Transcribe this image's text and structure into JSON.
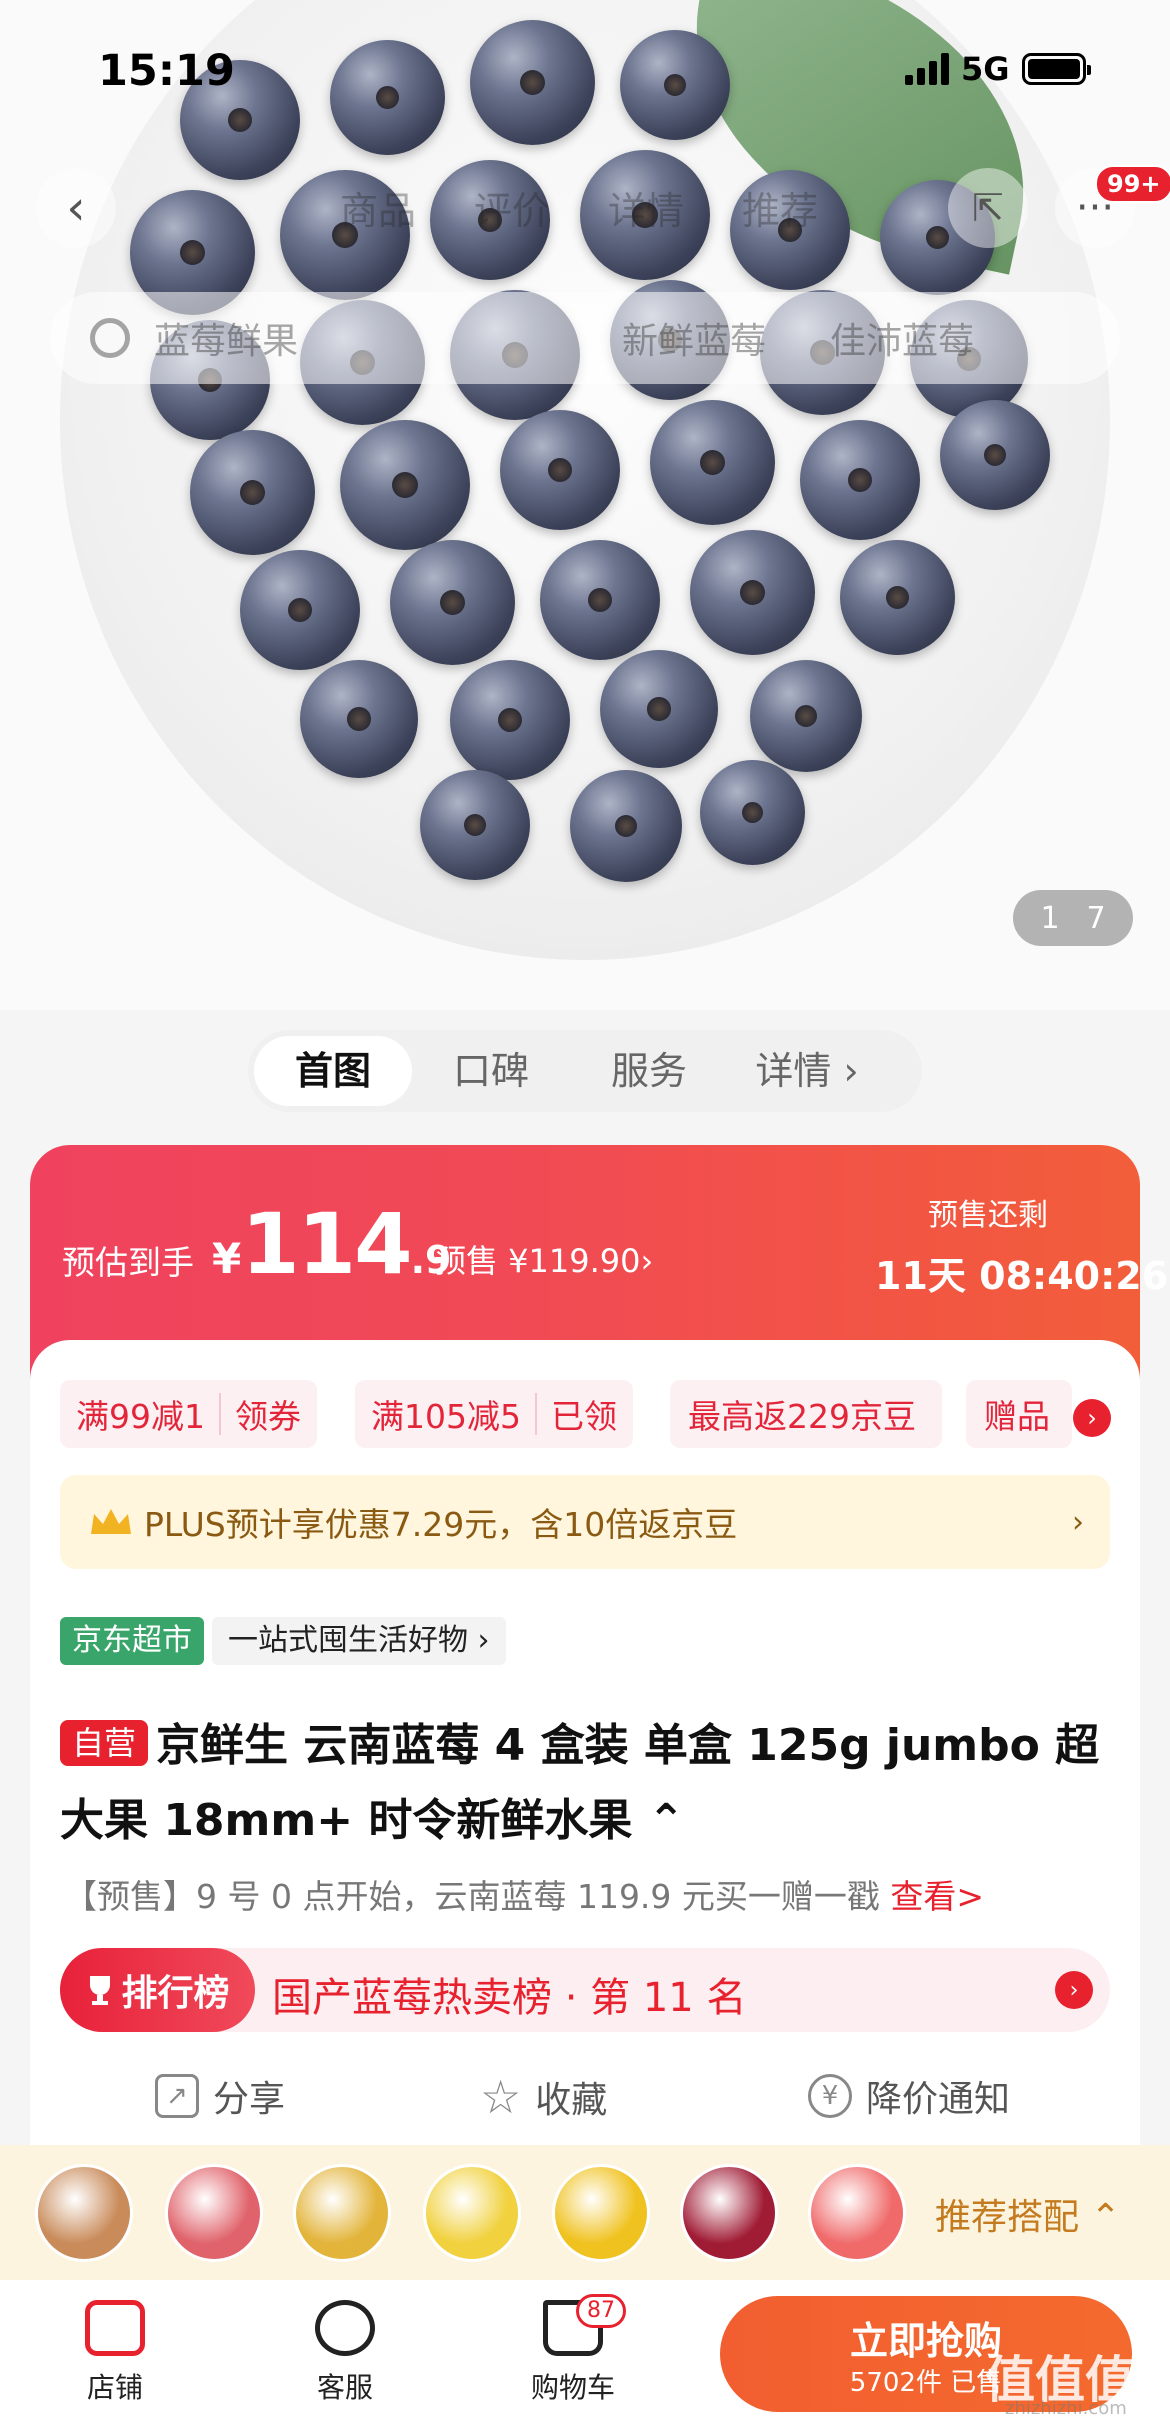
{
  "status": {
    "time": "15:19",
    "network": "5G"
  },
  "nav": {
    "tabs": [
      "商品",
      "评价",
      "详情",
      "推荐"
    ],
    "search_placeholder": "蓝莓鲜果",
    "search_hint2": "新鲜蓝莓",
    "search_hint3": "佳沛蓝莓",
    "badge": "99+"
  },
  "gallery": {
    "current": "1",
    "total": "7"
  },
  "segments": [
    "首图",
    "口碑",
    "服务",
    "详情 ›"
  ],
  "price": {
    "est_label": "预估到手",
    "currency": "¥",
    "int": "114",
    "dec": ".9",
    "presale": "预售 ¥119.90›",
    "left_label": "预售还剩",
    "countdown_days": "11天",
    "countdown_time": "08:40:26"
  },
  "coupons": [
    {
      "left": "满99减1",
      "right": "领券"
    },
    {
      "left": "满105减5",
      "right": "已领"
    },
    {
      "left": "最高返229京豆",
      "right": ""
    },
    {
      "left": "赠品",
      "right": ""
    }
  ],
  "plus": {
    "text": "PLUS预计享优惠7.29元，含10倍返京豆",
    "arrow": "›"
  },
  "store": {
    "tag": "京东超市",
    "slogan": "一站式囤生活好物 ›"
  },
  "product": {
    "self_tag": "自营",
    "title": "京鲜生 云南蓝莓 4 盒装 单盒 125g jumbo 超大果 18mm+ 时令新鲜水果 ⌃",
    "presale_note": "【预售】9 号 0 点开始，云南蓝莓 119.9 元买一赠一戳 ",
    "presale_link": "查看>"
  },
  "rank": {
    "tag": "排行榜",
    "text": "国产蓝莓热卖榜 · 第 11 名"
  },
  "actions": {
    "share": "分享",
    "fav": "收藏",
    "notify": "降价通知"
  },
  "recommend": {
    "label": "推荐搭配 ⌃",
    "thumb_colors": [
      "#c98b5a",
      "#e0636b",
      "#e3b43a",
      "#f1d13d",
      "#f0c21f",
      "#a01c35",
      "#f06a6a"
    ]
  },
  "bottom": {
    "shop": "店铺",
    "service": "客服",
    "cart": "购物车",
    "cart_count": "87",
    "buy_main": "立即抢购",
    "buy_sub": "5702件 已售"
  },
  "watermark": {
    "main": "值值值",
    "sub": "zhizhizhi.com"
  }
}
